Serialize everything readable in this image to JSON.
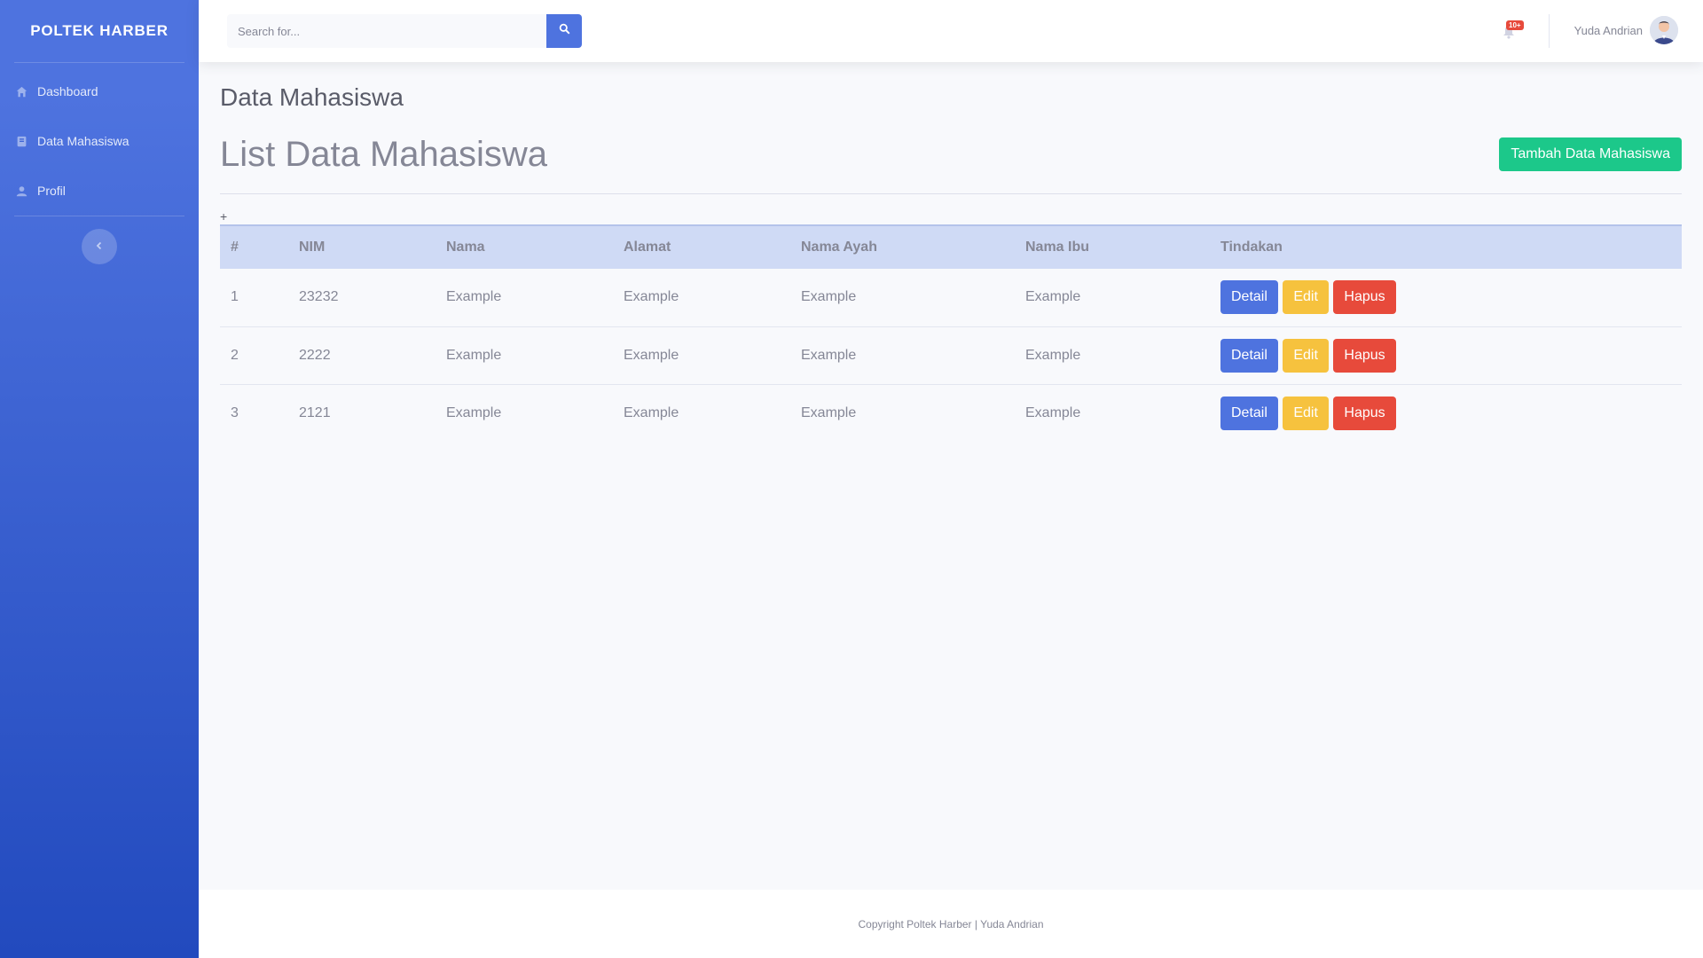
{
  "sidebar": {
    "brand": "POLTEK HARBER",
    "items": [
      {
        "label": "Dashboard",
        "icon": "home-icon"
      },
      {
        "label": "Data Mahasiswa",
        "icon": "book-icon"
      },
      {
        "label": "Profil",
        "icon": "user-icon"
      }
    ],
    "toggle_icon": "chevron-left-icon"
  },
  "topbar": {
    "search": {
      "placeholder": "Search for...",
      "value": ""
    },
    "notifications": {
      "badge": "10+"
    },
    "user": {
      "name": "Yuda Andrian"
    }
  },
  "main": {
    "page_heading": "Data Mahasiswa",
    "list_title": "List Data Mahasiswa",
    "add_button": "Tambah Data Mahasiswa",
    "plus_text": "+",
    "table": {
      "headers": [
        "#",
        "NIM",
        "Nama",
        "Alamat",
        "Nama Ayah",
        "Nama Ibu",
        "Tindakan"
      ],
      "rows": [
        [
          "1",
          "23232",
          "Example",
          "Example",
          "Example",
          "Example"
        ],
        [
          "2",
          "2222",
          "Example",
          "Example",
          "Example",
          "Example"
        ],
        [
          "3",
          "2121",
          "Example",
          "Example",
          "Example",
          "Example"
        ]
      ],
      "actions": {
        "detail": "Detail",
        "edit": "Edit",
        "hapus": "Hapus"
      }
    }
  },
  "footer": {
    "text": "Copyright Poltek Harber | Yuda Andrian"
  },
  "colors": {
    "primary": "#4e73df",
    "success": "#1cc88a",
    "warning": "#f6c23e",
    "danger": "#e74a3b"
  }
}
